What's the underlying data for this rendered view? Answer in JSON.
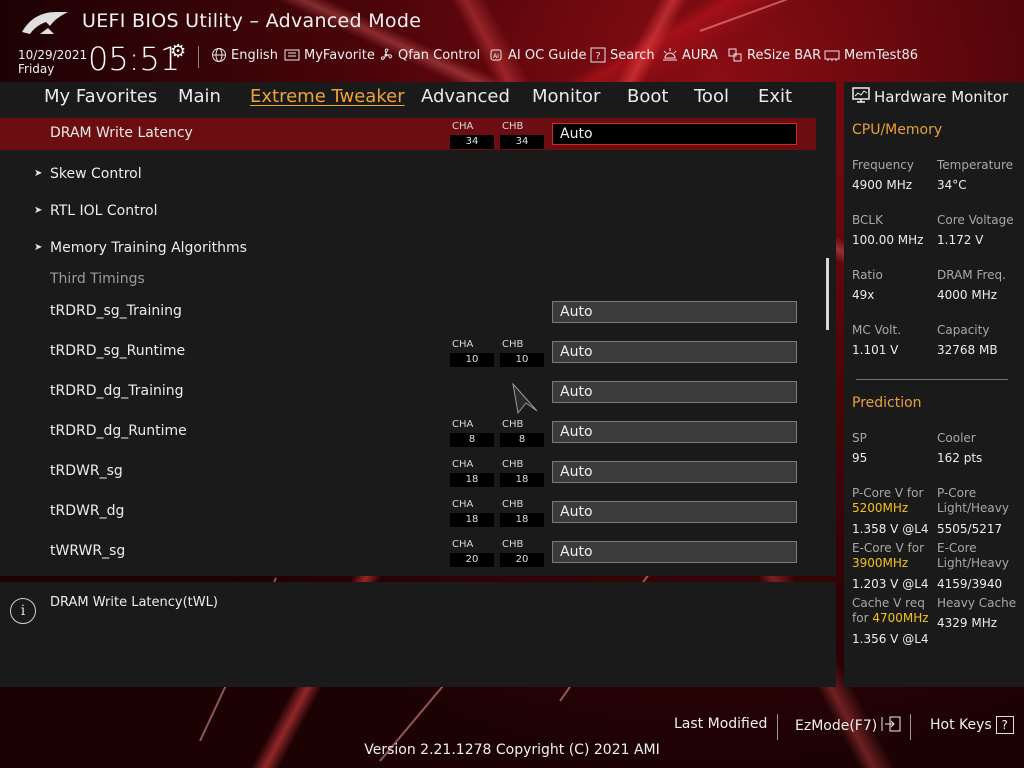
{
  "window": {
    "title": "UEFI BIOS Utility – Advanced Mode"
  },
  "datetime": {
    "date": "10/29/2021",
    "day": "Friday",
    "time": "05:51"
  },
  "toolbar": {
    "items": [
      {
        "label": "English",
        "icon": "globe-icon"
      },
      {
        "label": "MyFavorite",
        "icon": "favorite-list-icon"
      },
      {
        "label": "Qfan Control",
        "icon": "fan-icon"
      },
      {
        "label": "AI OC Guide",
        "icon": "ai-chip-icon"
      },
      {
        "label": "Search",
        "icon": "search-question-icon"
      },
      {
        "label": "AURA",
        "icon": "aura-light-icon"
      },
      {
        "label": "ReSize BAR",
        "icon": "resize-bar-icon"
      },
      {
        "label": "MemTest86",
        "icon": "memory-icon"
      }
    ]
  },
  "nav": {
    "tabs": [
      "My Favorites",
      "Main",
      "Extreme Tweaker",
      "Advanced",
      "Monitor",
      "Boot",
      "Tool",
      "Exit"
    ],
    "active": "Extreme Tweaker"
  },
  "settings": {
    "selected": {
      "label": "DRAM Write Latency",
      "cha_label": "CHA",
      "cha": "34",
      "chb_label": "CHB",
      "chb": "34",
      "value": "Auto"
    },
    "submenus": [
      "Skew Control",
      "RTL IOL Control",
      "Memory Training Algorithms"
    ],
    "section_header": "Third Timings",
    "rows": [
      {
        "label": "tRDRD_sg_Training",
        "value": "Auto"
      },
      {
        "label": "tRDRD_sg_Runtime",
        "cha_label": "CHA",
        "cha": "10",
        "chb_label": "CHB",
        "chb": "10",
        "value": "Auto"
      },
      {
        "label": "tRDRD_dg_Training",
        "value": "Auto"
      },
      {
        "label": "tRDRD_dg_Runtime",
        "cha_label": "CHA",
        "cha": "8",
        "chb_label": "CHB",
        "chb": "8",
        "value": "Auto"
      },
      {
        "label": "tRDWR_sg",
        "cha_label": "CHA",
        "cha": "18",
        "chb_label": "CHB",
        "chb": "18",
        "value": "Auto"
      },
      {
        "label": "tRDWR_dg",
        "cha_label": "CHA",
        "cha": "18",
        "chb_label": "CHB",
        "chb": "18",
        "value": "Auto"
      },
      {
        "label": "tWRWR_sg",
        "cha_label": "CHA",
        "cha": "20",
        "chb_label": "CHB",
        "chb": "20",
        "value": "Auto"
      }
    ]
  },
  "help": {
    "text": "DRAM Write Latency(tWL)"
  },
  "hardware_monitor": {
    "title": "Hardware Monitor",
    "cpu_section": "CPU/Memory",
    "cpu": {
      "frequency_label": "Frequency",
      "frequency": "4900 MHz",
      "temperature_label": "Temperature",
      "temperature": "34°C",
      "bclk_label": "BCLK",
      "bclk": "100.00 MHz",
      "core_voltage_label": "Core Voltage",
      "core_voltage": "1.172 V",
      "ratio_label": "Ratio",
      "ratio": "49x",
      "dram_freq_label": "DRAM Freq.",
      "dram_freq": "4000 MHz",
      "mc_volt_label": "MC Volt.",
      "mc_volt": "1.101 V",
      "capacity_label": "Capacity",
      "capacity": "32768 MB"
    },
    "prediction_section": "Prediction",
    "prediction": {
      "sp_label": "SP",
      "sp": "95",
      "cooler_label": "Cooler",
      "cooler": "162 pts",
      "pcore_label": "P-Core V for",
      "pcore_freq": "5200MHz",
      "pcore_v": "1.358 V @L4",
      "pcore_lh_label1": "P-Core",
      "pcore_lh_label2": "Light/Heavy",
      "pcore_lh": "5505/5217",
      "ecore_label": "E-Core V for",
      "ecore_freq": "3900MHz",
      "ecore_v": "1.203 V @L4",
      "ecore_lh_label1": "E-Core",
      "ecore_lh_label2": "Light/Heavy",
      "ecore_lh": "4159/3940",
      "cache_label1": "Cache V req",
      "cache_label2": "for",
      "cache_freq": "4700MHz",
      "cache_v": "1.356 V @L4",
      "heavy_cache_label": "Heavy Cache",
      "heavy_cache": "4329 MHz"
    }
  },
  "footer": {
    "last_modified": "Last Modified",
    "ezmode": "EzMode(F7)",
    "hotkeys": "Hot Keys",
    "hotkeys_key": "?",
    "version": "Version 2.21.1278 Copyright (C) 2021 AMI"
  },
  "colors": {
    "accent_orange": "#f0a332",
    "selected_row": "#6b0d11",
    "highlight_yellow": "#f2c416"
  }
}
